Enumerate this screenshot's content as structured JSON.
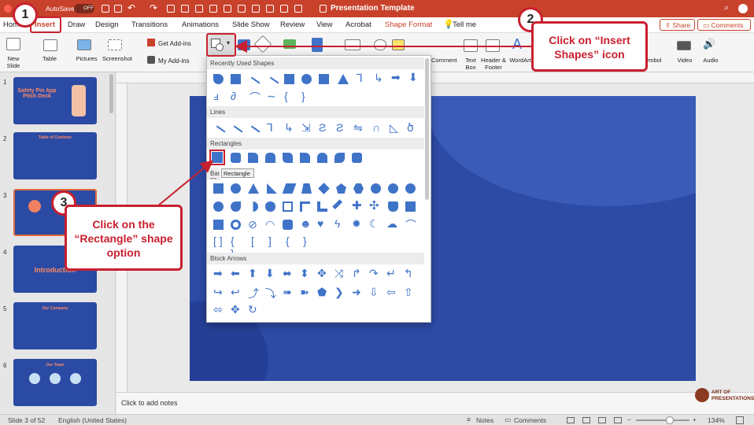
{
  "titlebar": {
    "autosave_label": "AutoSave",
    "autosave_state": "OFF",
    "title": "Presentation Template",
    "search_icon": "search-icon"
  },
  "tabs": [
    "Home",
    "Insert",
    "Draw",
    "Design",
    "Transitions",
    "Animations",
    "Slide Show",
    "Review",
    "View",
    "Acrobat",
    "Shape Format",
    "Tell me"
  ],
  "share": "Share",
  "comments": "Comments",
  "ribbon": {
    "new_slide": "New Slide",
    "table": "Table",
    "pictures": "Pictures",
    "screenshot": "Screenshot",
    "get_addins": "Get Add-ins",
    "my_addins": "My Add-ins",
    "comment": "Comment",
    "text_box": "Text Box",
    "header_footer": "Header & Footer",
    "wordart": "WordArt",
    "video": "Video",
    "audio": "Audio",
    "symbol": "Symbol"
  },
  "gallery": {
    "sections": [
      "Recently Used Shapes",
      "Lines",
      "Rectangles",
      "Basic Shapes",
      "Block Arrows"
    ],
    "tooltip": "Rectangle"
  },
  "slides": [
    {
      "num": "1",
      "title": "Safety Pin App Pitch Deck"
    },
    {
      "num": "2",
      "title": "Table of Contents"
    },
    {
      "num": "3",
      "title": ""
    },
    {
      "num": "4",
      "title": "Introduction"
    },
    {
      "num": "5",
      "title": "Our Company"
    },
    {
      "num": "6",
      "title": "Our Team"
    }
  ],
  "notes_placeholder": "Click to add notes",
  "status": {
    "slide": "Slide 3 of 52",
    "language": "English (United States)",
    "notes": "Notes",
    "comments": "Comments",
    "zoom": "134%"
  },
  "callouts": {
    "step1": "1",
    "step2": "2",
    "step3": "3",
    "step2_text": "Click on “Insert Shapes” icon",
    "step3_text": "Click on the “Rectangle” shape option"
  },
  "logo_text": "ART OF PRESENTATIONS",
  "colors": {
    "accent": "#c8412a",
    "shape_blue": "#3f73c8",
    "slide_bg": "#2d4aa5",
    "callout_red": "#c8202f"
  }
}
